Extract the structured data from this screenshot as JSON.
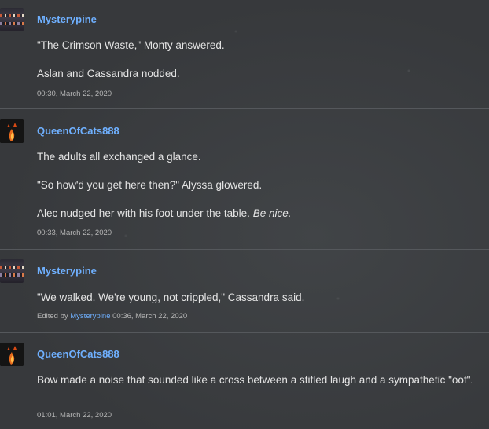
{
  "posts": [
    {
      "username": "Mysterypine",
      "lines": [
        "\"The Crimson Waste,\" Monty answered.",
        "Aslan and Cassandra nodded."
      ],
      "timestamp": "00:30, March 22, 2020"
    },
    {
      "username": "QueenOfCats888",
      "lines": [
        "The adults all exchanged a glance.",
        "\"So how'd you get here then?\" Alyssa glowered.",
        "Alec nudged her with his foot under the table.",
        "Be nice."
      ],
      "timestamp": "00:33, March 22, 2020"
    },
    {
      "username": "Mysterypine",
      "lines": [
        "\"We walked. We're young, not crippled,\" Cassandra said."
      ],
      "edited_prefix": "Edited by",
      "edited_by": "Mysterypine",
      "timestamp": "00:36, March 22, 2020"
    },
    {
      "username": "QueenOfCats888",
      "lines": [
        "Bow made a noise that sounded like a cross between a stifled laugh and a sympathetic \"oof\"."
      ],
      "timestamp": "01:01, March 22, 2020"
    }
  ],
  "colors": {
    "username": "#6fb0ff",
    "background": "#3a3d40",
    "separator": "#55585c"
  }
}
